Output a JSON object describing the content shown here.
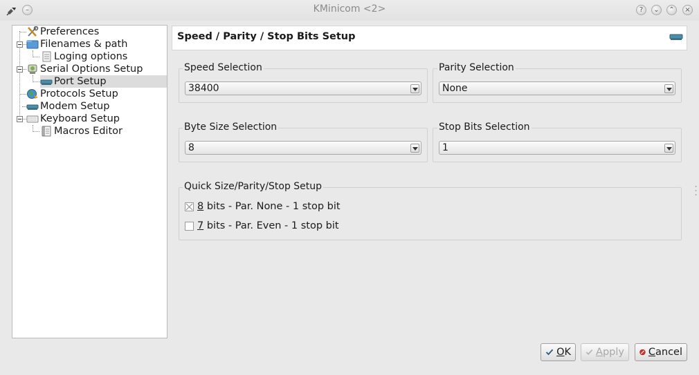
{
  "window": {
    "title": "KMinicom <2>",
    "controls": [
      "help",
      "minimize",
      "maximize",
      "close"
    ]
  },
  "tree": {
    "items": [
      {
        "label": "Preferences",
        "icon": "tools-icon",
        "level": 0
      },
      {
        "label": "Filenames & path",
        "icon": "folder-icon",
        "level": 0
      },
      {
        "label": "Loging options",
        "icon": "document-icon",
        "level": 1
      },
      {
        "label": "Serial Options Setup",
        "icon": "serial-device-icon",
        "level": 0
      },
      {
        "label": "Port Setup",
        "icon": "port-icon",
        "level": 1,
        "selected": true
      },
      {
        "label": "Protocols Setup",
        "icon": "globe-icon",
        "level": 0
      },
      {
        "label": "Modem Setup",
        "icon": "modem-icon",
        "level": 0
      },
      {
        "label": "Keyboard Setup",
        "icon": "keyboard-icon",
        "level": 0
      },
      {
        "label": "Macros Editor",
        "icon": "scroll-icon",
        "level": 1
      }
    ]
  },
  "header": {
    "title": "Speed / Parity / Stop Bits Setup",
    "icon": "modem-icon"
  },
  "speed": {
    "label": "Speed Selection",
    "value": "38400"
  },
  "parity": {
    "label": "Parity Selection",
    "value": "None"
  },
  "byte_size": {
    "label": "Byte Size Selection",
    "value": "8"
  },
  "stop_bits": {
    "label": "Stop Bits Selection",
    "value": "1"
  },
  "quick": {
    "label": "Quick Size/Parity/Stop Setup",
    "options": [
      {
        "mnemonic": "8",
        "rest": " bits - Par. None - 1 stop bit",
        "checked": true
      },
      {
        "mnemonic": "7",
        "rest": " bits - Par. Even - 1 stop bit",
        "checked": false
      }
    ]
  },
  "buttons": {
    "ok": {
      "mnemonic": "O",
      "rest": "K"
    },
    "apply": {
      "mnemonic": "A",
      "rest": "pply",
      "disabled": true
    },
    "cancel": {
      "mnemonic": "C",
      "rest": "ancel"
    }
  }
}
